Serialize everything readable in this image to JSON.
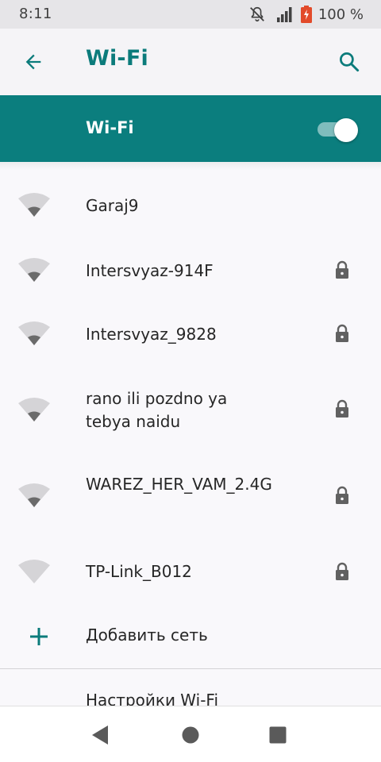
{
  "status_bar": {
    "time": "8:11",
    "battery_percent": "100 %",
    "icons": [
      "notifications-off-icon",
      "cell-signal-icon",
      "battery-charging-icon"
    ]
  },
  "app_bar": {
    "title": "Wi-Fi",
    "back_icon": "arrow-back-icon",
    "search_icon": "search-icon"
  },
  "master_switch": {
    "label": "Wi-Fi",
    "enabled": true
  },
  "networks": [
    {
      "name": "Garaj9",
      "secured": false
    },
    {
      "name": "Intersvyaz-914F",
      "secured": true
    },
    {
      "name": "Intersvyaz_9828",
      "secured": true
    },
    {
      "name": "rano ili pozdno ya tebya naidu",
      "secured": true
    },
    {
      "name": "WAREZ_HER_VAM_2.4G",
      "secured": true
    },
    {
      "name": "TP-Link_B012",
      "secured": true
    }
  ],
  "add_network": {
    "label": "Добавить сеть",
    "icon": "plus-icon"
  },
  "wifi_settings": {
    "label": "Настройки Wi-Fi"
  },
  "nav_bar": {
    "buttons": [
      "back-triangle-icon",
      "home-circle-icon",
      "recents-square-icon"
    ]
  },
  "colors": {
    "accent": "#0b7e7e",
    "title": "#0b7b7b",
    "status_bar_bg": "#e6e5e8",
    "icon_gray": "#616161"
  }
}
